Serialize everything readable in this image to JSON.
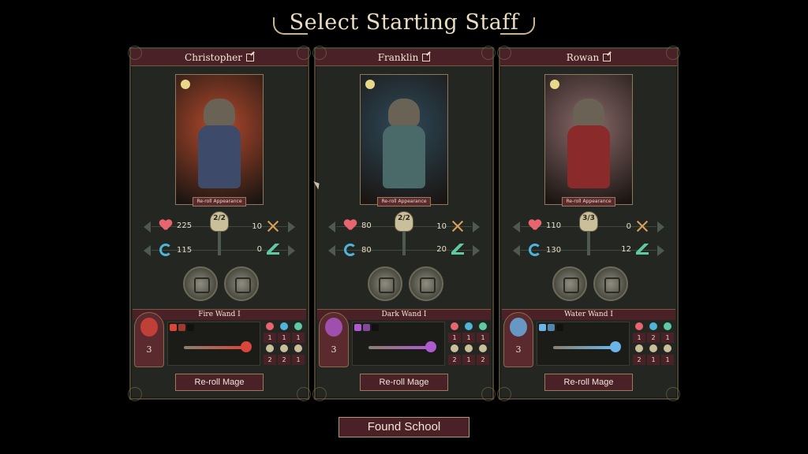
{
  "title": "Select Starting Staff",
  "found_button": "Found School",
  "reroll_appearance_label": "Re-roll Appearance",
  "reroll_mage_label": "Re-roll Mage",
  "mages": [
    {
      "name": "Christopher",
      "health": "225",
      "attack": "10",
      "mana": "115",
      "speed": "0",
      "skull_count": "2/2",
      "wand_name": "Fire Wand I",
      "wand_tier": "3",
      "wand_color": "#d9463a",
      "stats_grid": [
        "1",
        "1",
        "1",
        "2",
        "2",
        "1"
      ],
      "portrait_bg": "#b34a2c",
      "body_color": "#3e4a6a"
    },
    {
      "name": "Franklin",
      "health": "80",
      "attack": "10",
      "mana": "80",
      "speed": "20",
      "skull_count": "2/2",
      "wand_name": "Dark Wand I",
      "wand_tier": "3",
      "wand_color": "#b05ad0",
      "stats_grid": [
        "1",
        "1",
        "1",
        "2",
        "1",
        "2"
      ],
      "portrait_bg": "#2e4a5a",
      "body_color": "#4a6a6a"
    },
    {
      "name": "Rowan",
      "health": "110",
      "attack": "0",
      "mana": "130",
      "speed": "12",
      "skull_count": "3/3",
      "wand_name": "Water Wand I",
      "wand_tier": "3",
      "wand_color": "#6ab4e8",
      "stats_grid": [
        "1",
        "2",
        "1",
        "2",
        "1",
        "1"
      ],
      "portrait_bg": "#8a6a6a",
      "body_color": "#8a2a2a"
    }
  ]
}
